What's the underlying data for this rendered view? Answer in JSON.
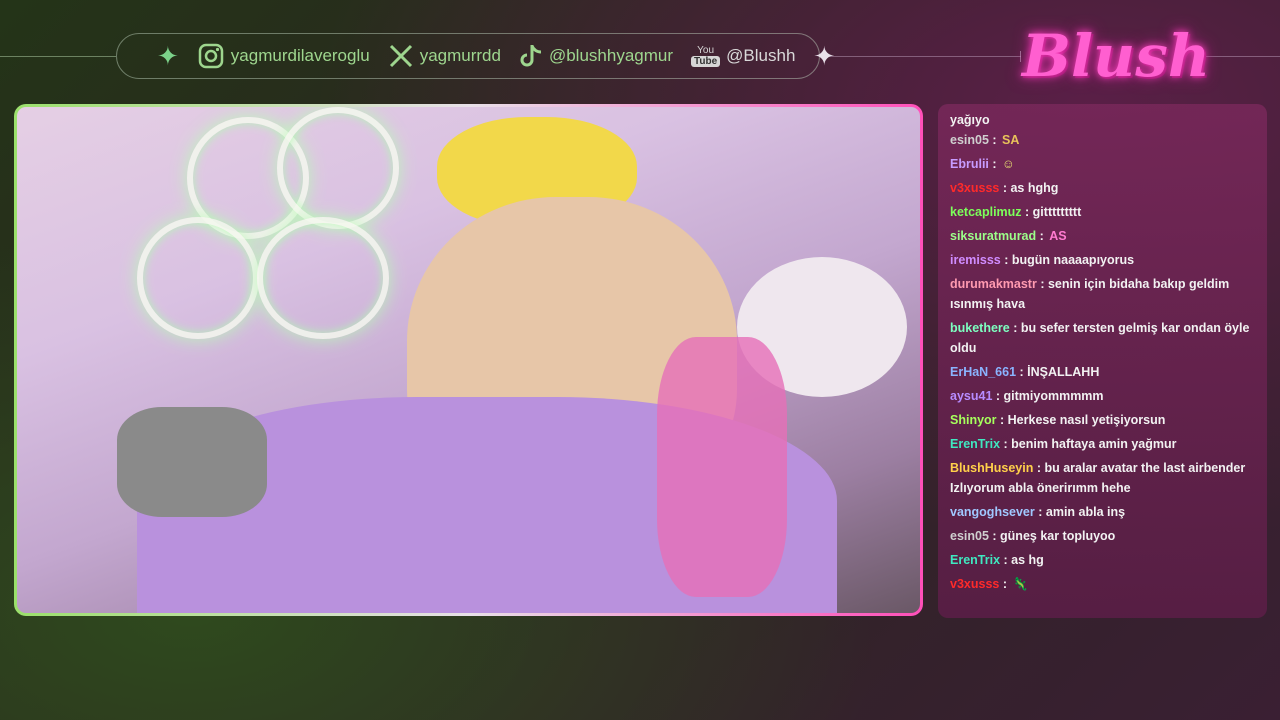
{
  "social": {
    "instagram": "yagmurdilaveroglu",
    "x": "yagmurrdd",
    "tiktok": "@blushhyagmur",
    "youtube_logo_top": "You",
    "youtube_logo_bottom": "Tube",
    "youtube": "@Blushh"
  },
  "brand": {
    "logo_text": "Blush"
  },
  "chat": {
    "partial_top": "yağıyo",
    "messages": [
      {
        "user": "esin05",
        "color": "#cfcfcf",
        "text": "",
        "emote": "SA",
        "emote_color": "#e8c25a"
      },
      {
        "user": "Ebrulii",
        "color": "#c79cff",
        "text": "",
        "emote": "☺",
        "emote_color": "#e8e070"
      },
      {
        "user": "v3xusss",
        "color": "#ff2a2a",
        "text": "as hghg",
        "emote": "",
        "emote_color": ""
      },
      {
        "user": "ketcaplimuz",
        "color": "#7cff5a",
        "text": "gittttttttt",
        "emote": "",
        "emote_color": ""
      },
      {
        "user": "siksuratmurad",
        "color": "#9cff8a",
        "text": "",
        "emote": "AS",
        "emote_color": "#ff7ad0"
      },
      {
        "user": "iremisss",
        "color": "#d08cff",
        "text": "bugün naaaapıyorus",
        "emote": "",
        "emote_color": ""
      },
      {
        "user": "durumakmastr",
        "color": "#ff9ab0",
        "text": "senin için bidaha bakıp geldim ısınmış hava",
        "emote": "",
        "emote_color": ""
      },
      {
        "user": "bukethere",
        "color": "#7dffc0",
        "text": "bu sefer tersten gelmiş kar ondan öyle oldu",
        "emote": "",
        "emote_color": ""
      },
      {
        "user": "ErHaN_661",
        "color": "#8ab4ff",
        "text": "İNŞALLAHH",
        "emote": "",
        "emote_color": ""
      },
      {
        "user": "aysu41",
        "color": "#b78cff",
        "text": "gitmiyommmmm",
        "emote": "",
        "emote_color": ""
      },
      {
        "user": "Shinyor",
        "color": "#a6ff5c",
        "text": "Herkese nasıl yetişiyorsun",
        "emote": "",
        "emote_color": ""
      },
      {
        "user": "ErenTrix",
        "color": "#3fe8c0",
        "text": "benim haftaya amin yağmur",
        "emote": "",
        "emote_color": ""
      },
      {
        "user": "BlushHuseyin",
        "color": "#ffd04a",
        "text": "bu aralar avatar the last airbender Izlıyorum abla önerirımm hehe",
        "emote": "",
        "emote_color": ""
      },
      {
        "user": "vangoghsever",
        "color": "#a0c8ff",
        "text": "amin abla inş",
        "emote": "",
        "emote_color": ""
      },
      {
        "user": "esin05",
        "color": "#cfcfcf",
        "text": "güneş kar topluyoo",
        "emote": "",
        "emote_color": ""
      },
      {
        "user": "ErenTrix",
        "color": "#3fe8c0",
        "text": "as hg",
        "emote": "",
        "emote_color": ""
      },
      {
        "user": "v3xusss",
        "color": "#ff2a2a",
        "text": "",
        "emote": "🦎",
        "emote_color": "#4cd84c"
      }
    ]
  },
  "colors": {
    "accent_pink": "#ff4fb9",
    "accent_green": "#9be06b",
    "social_text": "#9ed68e"
  }
}
